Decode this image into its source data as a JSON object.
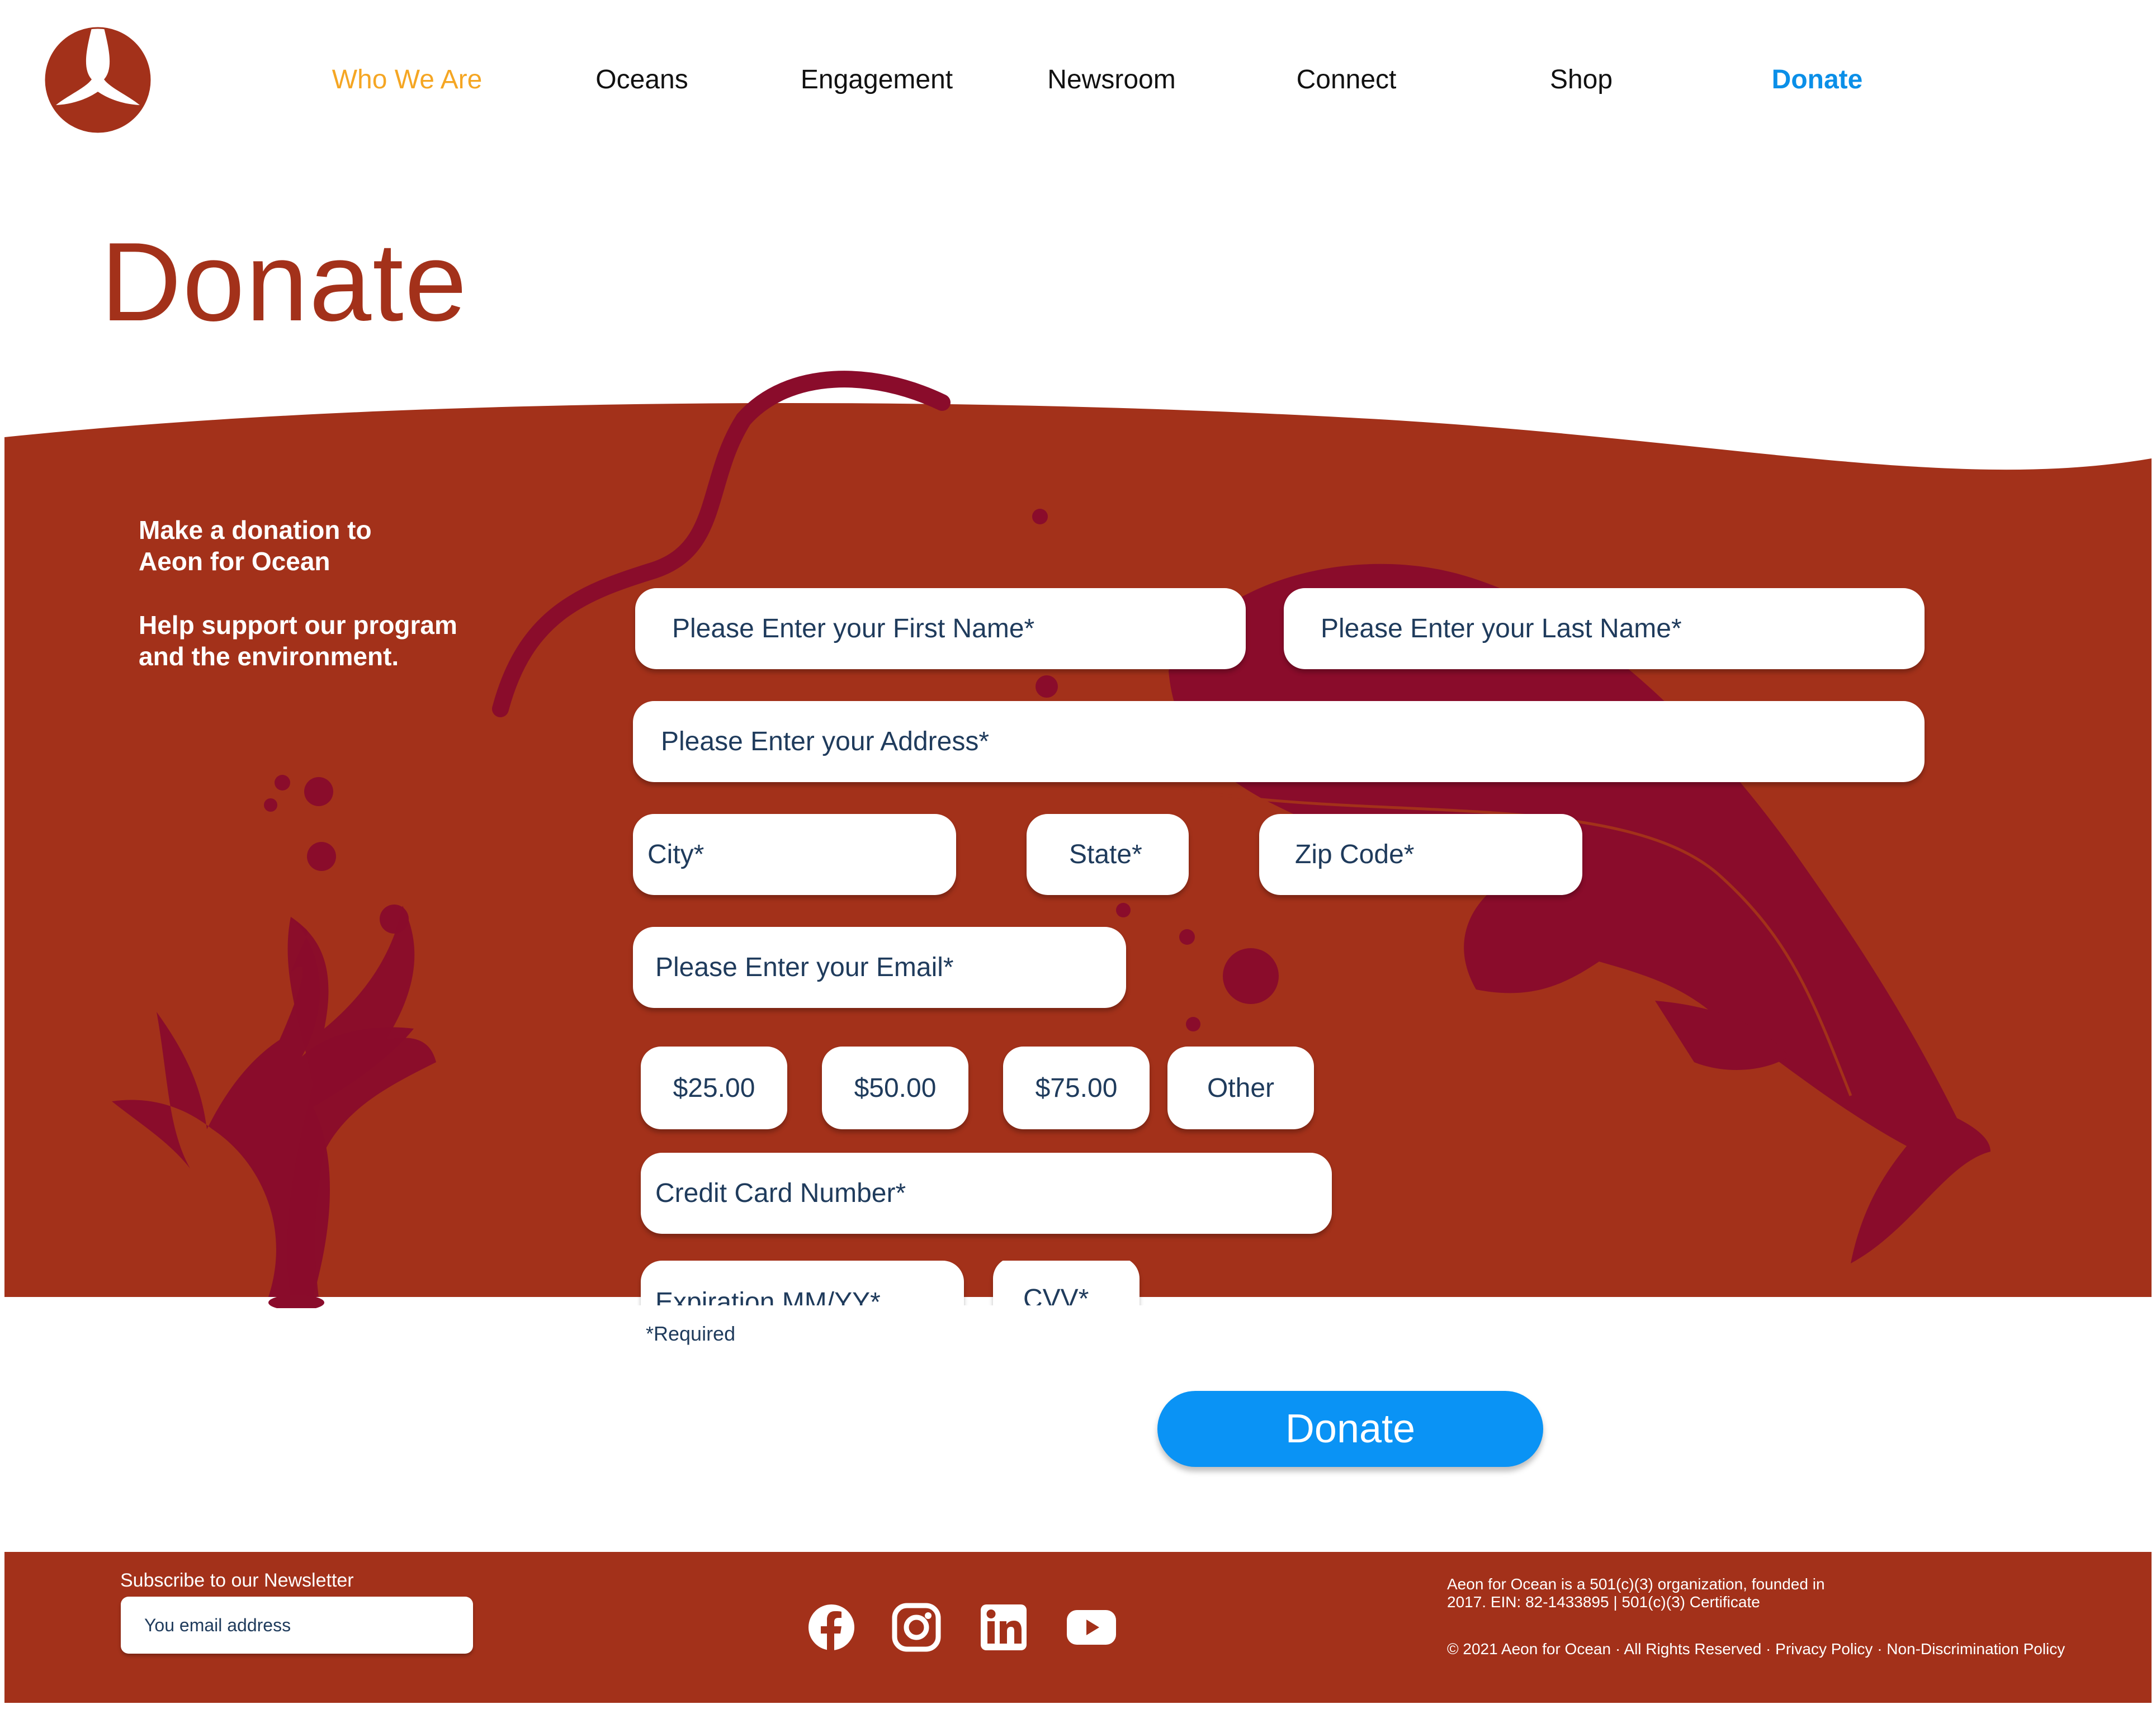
{
  "brand": {
    "logo_icon": "whale-tail-logo",
    "primary_color": "#A3311A",
    "accent_color": "#0A8FE8",
    "active_nav_color": "#F5A623"
  },
  "nav": {
    "items": [
      {
        "label": "Who We Are"
      },
      {
        "label": "Oceans"
      },
      {
        "label": "Engagement"
      },
      {
        "label": "Newsroom"
      },
      {
        "label": "Connect"
      },
      {
        "label": "Shop"
      },
      {
        "label": "Donate"
      }
    ]
  },
  "page": {
    "title": "Donate"
  },
  "intro": {
    "line1": "Make a donation to",
    "line2": "Aeon for Ocean",
    "line3": "Help support our program",
    "line4": "and the environment."
  },
  "form": {
    "first_name_placeholder": "Please Enter your First Name*",
    "last_name_placeholder": "Please Enter your Last Name*",
    "address_placeholder": "Please Enter your Address*",
    "city_placeholder": "City*",
    "state_placeholder": "State*",
    "zip_placeholder": "Zip Code*",
    "email_placeholder": "Please Enter your Email*",
    "amounts": [
      "$25.00",
      "$50.00",
      "$75.00",
      "Other"
    ],
    "card_placeholder": "Credit Card Number*",
    "expiration_placeholder": "Expiration MM/YY*",
    "cvv_placeholder": "CVV*",
    "required_note": "*Required",
    "submit_label": "Donate"
  },
  "footer": {
    "newsletter_label": "Subscribe to our Newsletter",
    "newsletter_placeholder": "You email address",
    "social_icons": [
      "facebook-icon",
      "instagram-icon",
      "linkedin-icon",
      "youtube-icon"
    ],
    "org_line1": "Aeon for Ocean is a 501(c)(3) organization, founded in",
    "org_line2": "2017. EIN: 82-1433895 | 501(c)(3) Certificate",
    "copyright": "© 2021 Aeon for Ocean · All Rights Reserved · Privacy Policy · Non-Discrimination Policy"
  }
}
